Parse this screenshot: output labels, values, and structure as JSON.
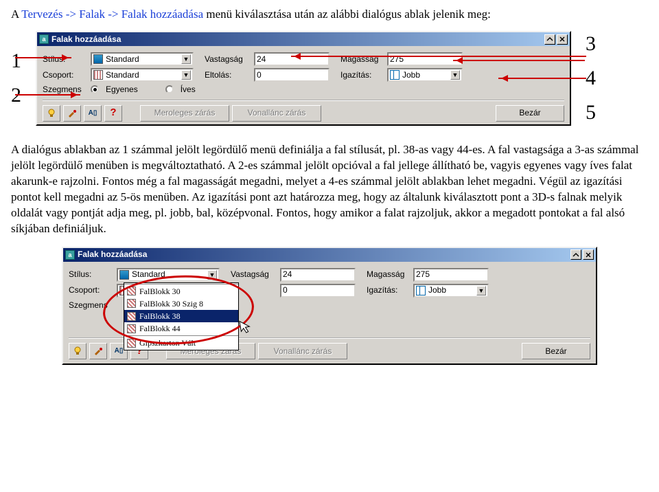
{
  "intro": {
    "prefix": "A ",
    "menu_path": "Tervezés -> Falak -> Falak hozzáadása",
    "suffix": " menü kiválasztása után az alábbi dialógus ablak jelenik meg:"
  },
  "callouts": {
    "n1": "1",
    "n2": "2",
    "n3": "3",
    "n4": "4",
    "n5": "5"
  },
  "dialog1": {
    "title": "Falak hozzáadása",
    "labels": {
      "stilus": "Stílus:",
      "vastagsag": "Vastagság",
      "magassag": "Magasság",
      "csoport": "Csoport:",
      "eltolas": "Eltolás:",
      "igazitas": "Igazítás:",
      "szegmens": "Szegmens"
    },
    "values": {
      "stilus": "Standard",
      "vastagsag": "24",
      "magassag": "275",
      "csoport": "Standard",
      "eltolas": "0",
      "igazitas": "Jobb"
    },
    "radios": {
      "egyenes": "Egyenes",
      "ives": "Íves"
    },
    "buttons": {
      "meroleges": "Meroleges zárás",
      "vonallanc": "Vonallánc zárás",
      "bezar": "Bezár"
    }
  },
  "paragraph": "A dialógus ablakban az 1 számmal jelölt legördülő menü definiálja a fal stílusát, pl. 38-as vagy 44-es. A fal vastagsága a 3-as számmal jelölt legördülő menüben is megváltoztatható. A 2-es számmal jelölt opcióval a fal jellege állítható be, vagyis egyenes vagy íves falat akarunk-e rajzolni. Fontos még a fal magasságát megadni, melyet a 4-es számmal jelölt ablakban lehet megadni. Végül az igazítási pontot kell megadni az 5-ös menüben. Az igazítási pont azt határozza meg, hogy az általunk kiválasztott pont a 3D-s falnak melyik oldalát vagy pontját adja meg, pl. jobb, bal, középvonal. Fontos, hogy amikor a falat rajzoljuk, akkor a megadott pontokat a fal alsó síkjában definiáljuk.",
  "dialog2": {
    "title": "Falak hozzáadása",
    "values": {
      "stilus": "Standard",
      "vastagsag": "24",
      "magassag": "275",
      "eltolas": "0",
      "igazitas": "Jobb"
    },
    "list": {
      "item1": "FalBlokk 30",
      "item2": "FalBlokk 30 Szig 8",
      "item3": "FalBlokk 38",
      "item4": "FalBlokk 44",
      "item5": "Gipszkarton Vált"
    },
    "buttons": {
      "meroleges": "Meroleges zárás",
      "vonallanc": "Vonallánc zárás",
      "bezar": "Bezár"
    }
  }
}
